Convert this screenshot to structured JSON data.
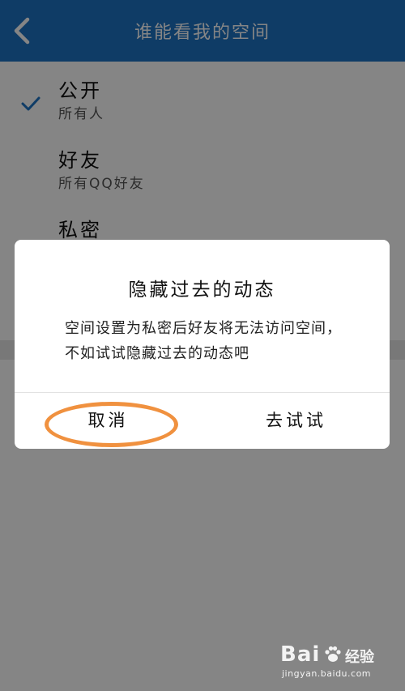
{
  "header": {
    "title": "谁能看我的空间",
    "back_icon": "chevron-left-icon"
  },
  "options": [
    {
      "title": "公开",
      "subtitle": "所有人",
      "selected": true
    },
    {
      "title": "好友",
      "subtitle": "所有QQ好友",
      "selected": false
    },
    {
      "title": "私密",
      "subtitle": "",
      "selected": false
    }
  ],
  "dialog": {
    "title": "隐藏过去的动态",
    "message": "空间设置为私密后好友将无法访问空间，不如试试隐藏过去的动态吧",
    "cancel_label": "取消",
    "confirm_label": "去试试"
  },
  "watermark": {
    "logo": "Bai",
    "brand": "经验",
    "url": "jingyan.baidu.com"
  },
  "colors": {
    "header_bg": "#1e73c4",
    "check": "#1e73c4",
    "highlight_ring": "#f0913f"
  }
}
